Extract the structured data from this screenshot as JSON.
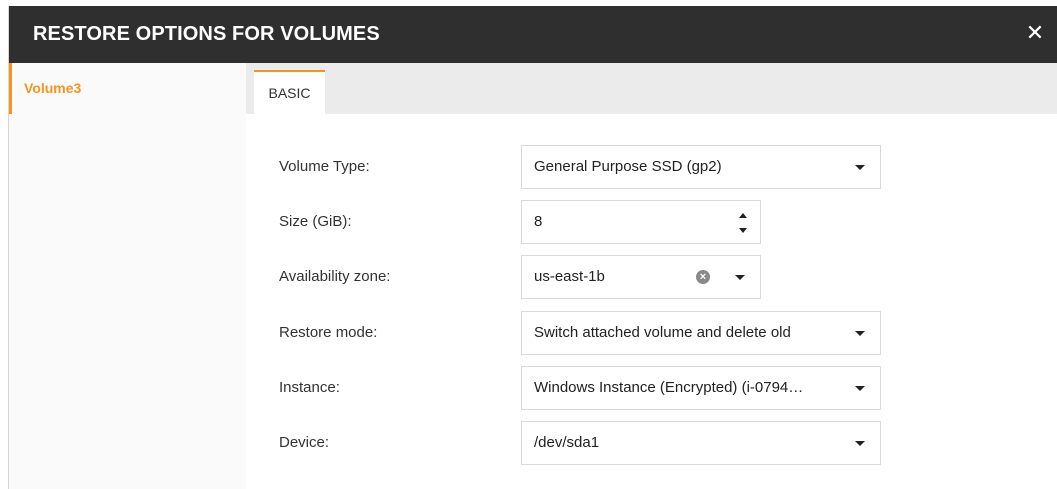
{
  "dialog": {
    "title": "RESTORE OPTIONS FOR VOLUMES",
    "close_glyph": "✕",
    "accent_color": "#f7941d"
  },
  "sidebar": {
    "items": [
      {
        "label": "Volume3",
        "selected": true
      }
    ]
  },
  "tabs": [
    {
      "label": "BASIC",
      "active": true
    }
  ],
  "form": {
    "volume_type": {
      "label": "Volume Type:",
      "value": "General Purpose SSD (gp2)"
    },
    "size": {
      "label": "Size (GiB):",
      "value": "8"
    },
    "availability_zone": {
      "label": "Availability zone:",
      "value": "us-east-1b"
    },
    "restore_mode": {
      "label": "Restore mode:",
      "value": "Switch attached volume and delete old"
    },
    "instance": {
      "label": "Instance:",
      "value": "Windows Instance (Encrypted) (i-0794…"
    },
    "device": {
      "label": "Device:",
      "value": "/dev/sda1"
    }
  }
}
